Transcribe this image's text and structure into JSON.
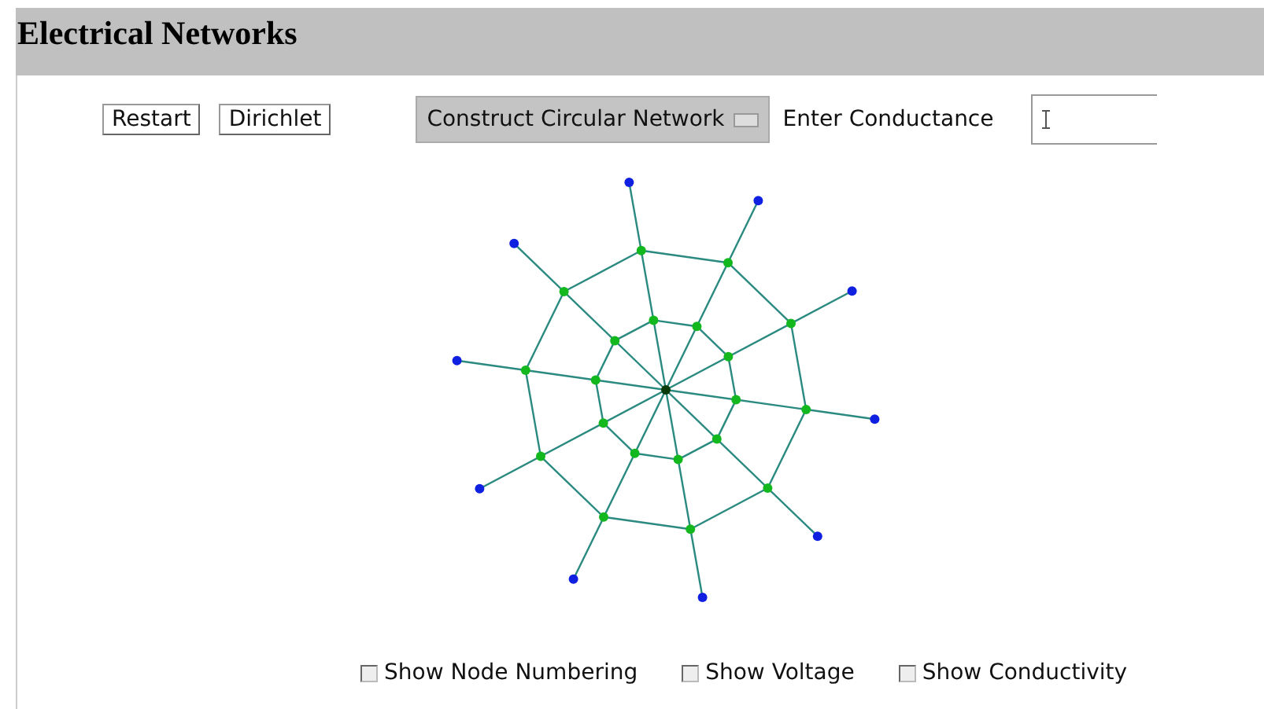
{
  "window": {
    "title": "Electrical Networks"
  },
  "toolbar": {
    "buttons": [
      "Restart",
      "Dirichlet"
    ],
    "dropdown": {
      "value": "Construct Circular Network"
    },
    "conductance": {
      "label": "Enter Conductance"
    }
  },
  "options": [
    {
      "label": "Show Node Numbering",
      "checked": false
    },
    {
      "label": "Show Voltage",
      "checked": false
    },
    {
      "label": "Show Conductivity",
      "checked": false
    }
  ]
}
